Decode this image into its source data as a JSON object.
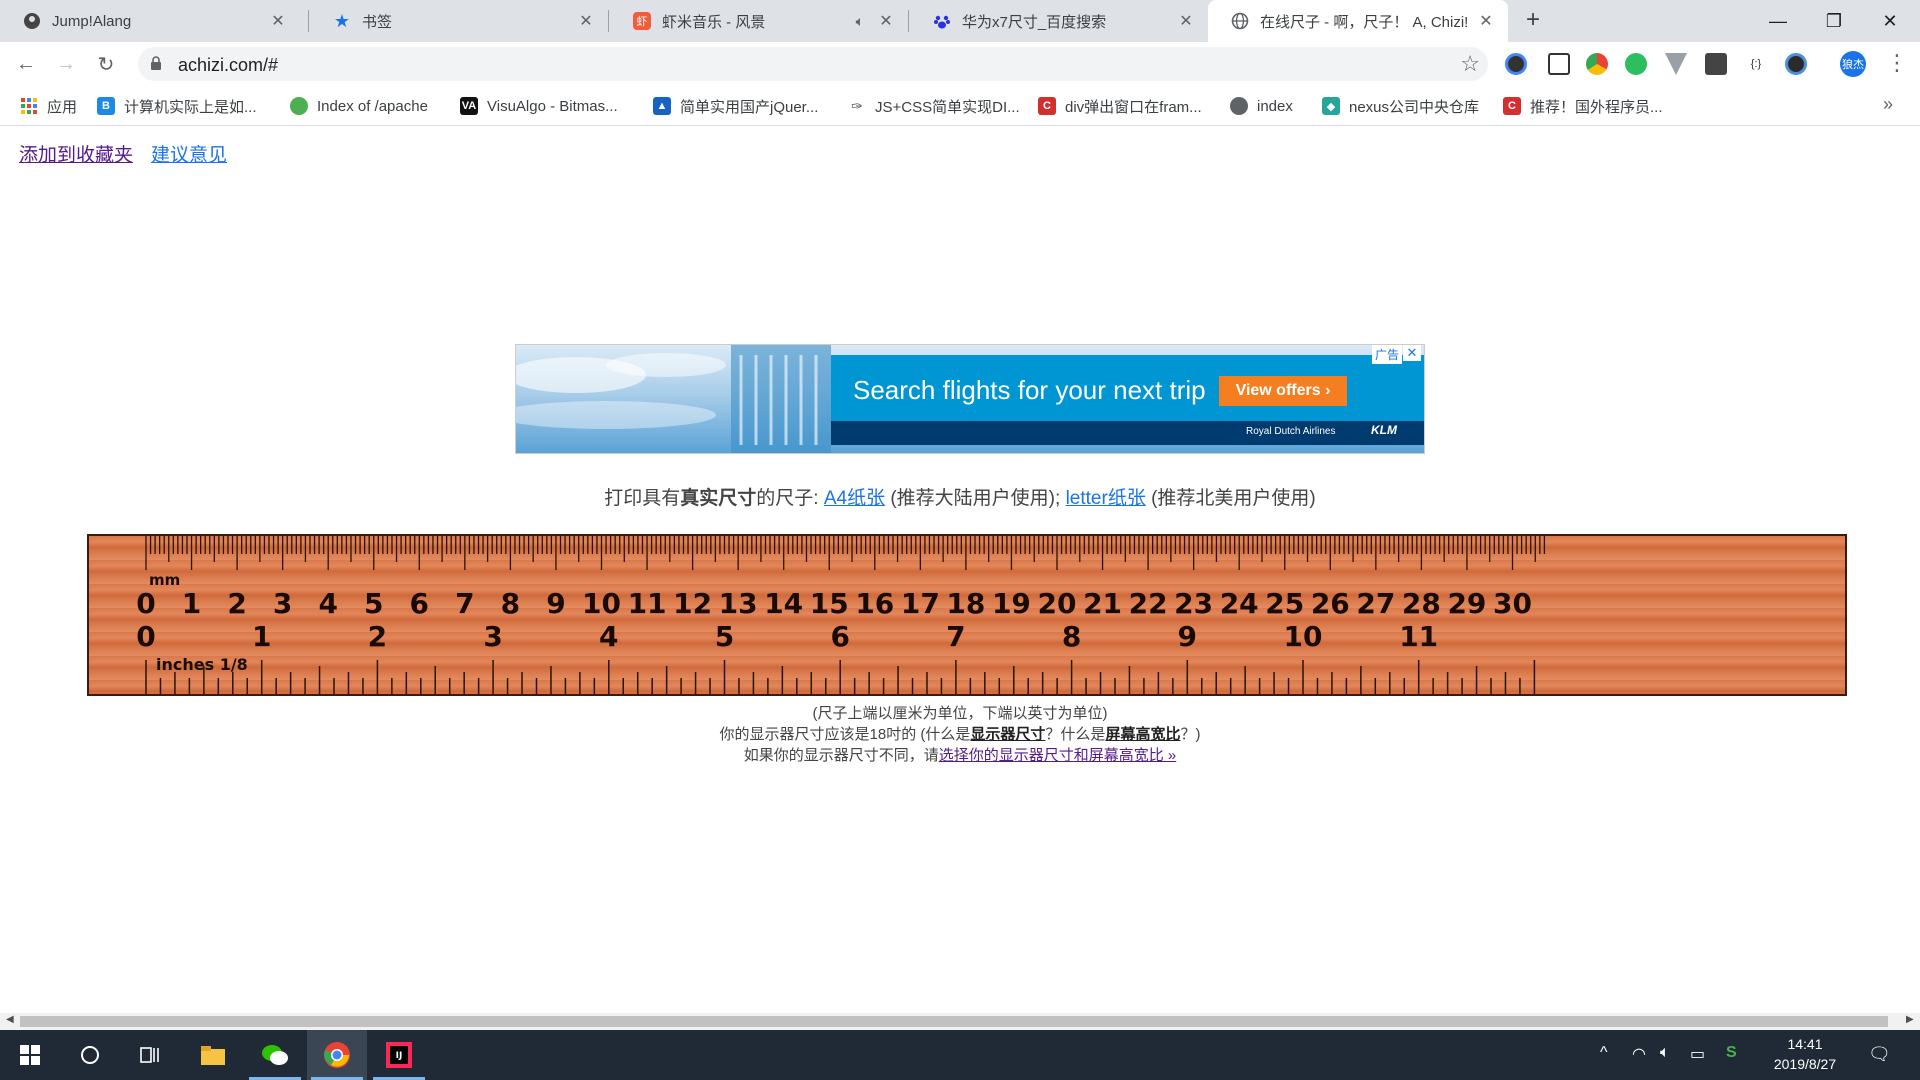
{
  "tabs": [
    {
      "title": "Jump!Alang",
      "icon": "avatar-icon",
      "active": false
    },
    {
      "title": "书签",
      "icon": "star-icon",
      "active": false
    },
    {
      "title": "虾米音乐 - 风景",
      "icon": "xiami-icon",
      "active": false,
      "muted": true
    },
    {
      "title": "华为x7尺寸_百度搜索",
      "icon": "baidu-icon",
      "active": false
    },
    {
      "title": "在线尺子 - 啊，尺子！ A, Chizi!",
      "icon": "globe-icon",
      "active": true
    }
  ],
  "toolbar": {
    "url": "achizi.com/#"
  },
  "profile": {
    "label": "狼杰"
  },
  "bookmarks": [
    {
      "label": "应用",
      "icon": "apps-grid-icon",
      "color": "#4285f4"
    },
    {
      "label": "计算机实际上是如...",
      "icon": "bookmark-b-icon",
      "color": "#1e88e5"
    },
    {
      "label": "Index of /apache",
      "icon": "globe-icon",
      "color": "#4caf50"
    },
    {
      "label": "VisuAlgo - Bitmas...",
      "icon": "visualgo-icon",
      "color": "#111111"
    },
    {
      "label": "简单实用国产jQuer...",
      "icon": "chart-icon",
      "color": "#1565c0"
    },
    {
      "label": "JS+CSS简单实现DI...",
      "icon": "feather-icon",
      "color": "#555555"
    },
    {
      "label": "div弹出窗口在fram...",
      "icon": "csdn-icon",
      "color": "#d32f2f"
    },
    {
      "label": "index",
      "icon": "globe-icon",
      "color": "#5f6368"
    },
    {
      "label": "nexus公司中央仓库",
      "icon": "cube-icon",
      "color": "#26a69a"
    },
    {
      "label": "推荐！国外程序员...",
      "icon": "csdn-icon",
      "color": "#d32f2f"
    }
  ],
  "page": {
    "link_favorite": "添加到收藏夹",
    "link_feedback": "建议意见",
    "ad": {
      "headline": "Search flights for your next trip",
      "cta": "View offers",
      "brand": "Royal Dutch Airlines",
      "logo": "KLM",
      "label": "广告",
      "close": "✕"
    },
    "print_line": {
      "prefix": "打印具有",
      "bold": "真实尺寸",
      "mid": "的尺子: ",
      "a4_link": "A4纸张",
      "a4_note": " (推荐大陆用户使用); ",
      "letter_link": "letter纸张",
      "letter_note": " (推荐北美用户使用)"
    },
    "ruler": {
      "mm_label": "mm",
      "inch_label": "inches 1/8",
      "cm_numbers": [
        "0",
        "1",
        "2",
        "3",
        "4",
        "5",
        "6",
        "7",
        "8",
        "9",
        "10",
        "11",
        "12",
        "13",
        "14",
        "15",
        "16",
        "17",
        "18",
        "19",
        "20",
        "21",
        "22",
        "23",
        "24",
        "25",
        "26",
        "27",
        "28",
        "29",
        "30"
      ],
      "inch_numbers": [
        "0",
        "1",
        "2",
        "3",
        "4",
        "5",
        "6",
        "7",
        "8",
        "9",
        "10",
        "11"
      ]
    },
    "note": {
      "line1": "(尺子上端以厘米为单位，下端以英寸为单位)",
      "line2_a": "你的显示器尺寸应该是18吋的 (什么是",
      "line2_link1": "显示器尺寸",
      "line2_b": "？什么是",
      "line2_link2": "屏幕高宽比",
      "line2_c": "？)",
      "line3_a": "如果你的显示器尺寸不同，请",
      "line3_link": "选择你的显示器尺寸和屏幕高宽比 »"
    }
  },
  "taskbar": {
    "time": "14:41",
    "date": "2019/8/27"
  }
}
